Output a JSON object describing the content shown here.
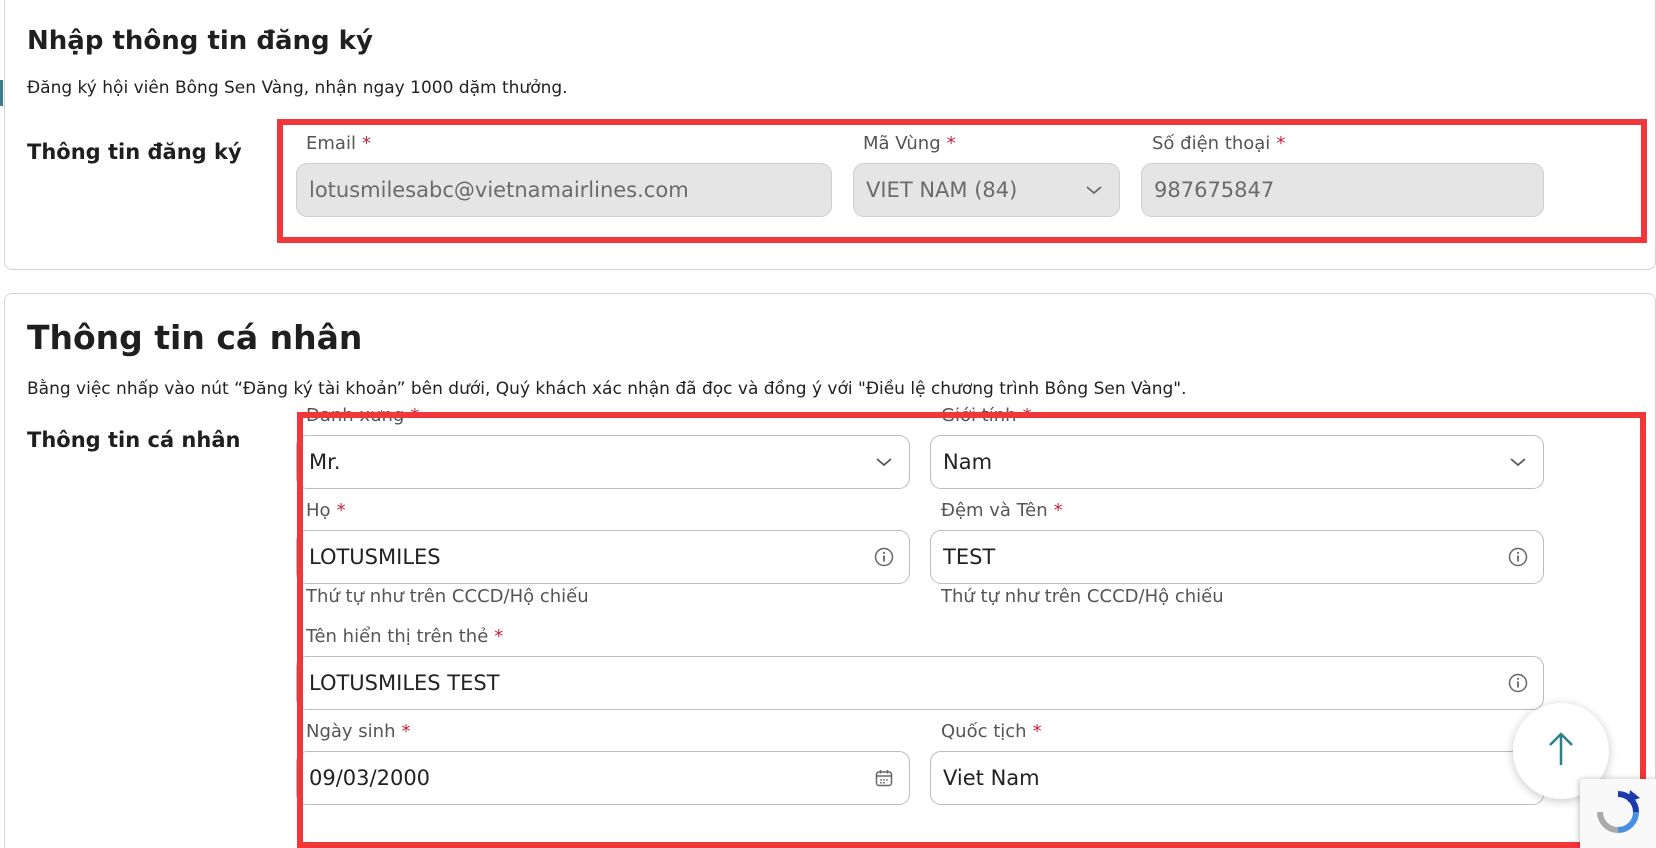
{
  "registration": {
    "title": "Nhập thông tin đăng ký",
    "description": "Đăng ký hội viên Bông Sen Vàng, nhận ngay 1000 dặm thưởng.",
    "section_label": "Thông tin đăng ký",
    "email": {
      "label": "Email",
      "required": "*",
      "value": "lotusmilesabc@vietnamairlines.com"
    },
    "area_code": {
      "label": "Mã Vùng",
      "required": "*",
      "value": "VIET NAM (84)"
    },
    "phone": {
      "label": "Số điện thoại",
      "required": "*",
      "value": "987675847"
    }
  },
  "personal": {
    "title": "Thông tin cá nhân",
    "description": "Bằng việc nhấp vào nút “Đăng ký tài khoản” bên dưới, Quý khách xác nhận đã đọc và đồng ý với \"Điều lệ chương trình Bông Sen Vàng\".",
    "section_label": "Thông tin cá nhân",
    "salutation": {
      "label": "Danh xưng",
      "required": "*",
      "value": "Mr."
    },
    "gender": {
      "label": "Giới tính",
      "required": "*",
      "value": "Nam"
    },
    "last_name": {
      "label": "Họ",
      "required": "*",
      "value": "LOTUSMILES",
      "hint": "Thứ tự như trên CCCD/Hộ chiếu"
    },
    "first_name": {
      "label": "Đệm và Tên",
      "required": "*",
      "value": "TEST",
      "hint": "Thứ tự như trên CCCD/Hộ chiếu"
    },
    "card_name": {
      "label": "Tên hiển thị trên thẻ",
      "required": "*",
      "value": "LOTUSMILES TEST"
    },
    "birthdate": {
      "label": "Ngày sinh",
      "required": "*",
      "value": "09/03/2000"
    },
    "nationality": {
      "label": "Quốc tịch",
      "required": "*",
      "value": "Viet Nam"
    }
  },
  "colors": {
    "highlight": "#f2373a",
    "required": "#c0243b",
    "accent": "#3a7d8c"
  },
  "icons": [
    "chevron-down-icon",
    "info-icon",
    "calendar-icon",
    "arrow-up-icon",
    "recaptcha-icon"
  ]
}
